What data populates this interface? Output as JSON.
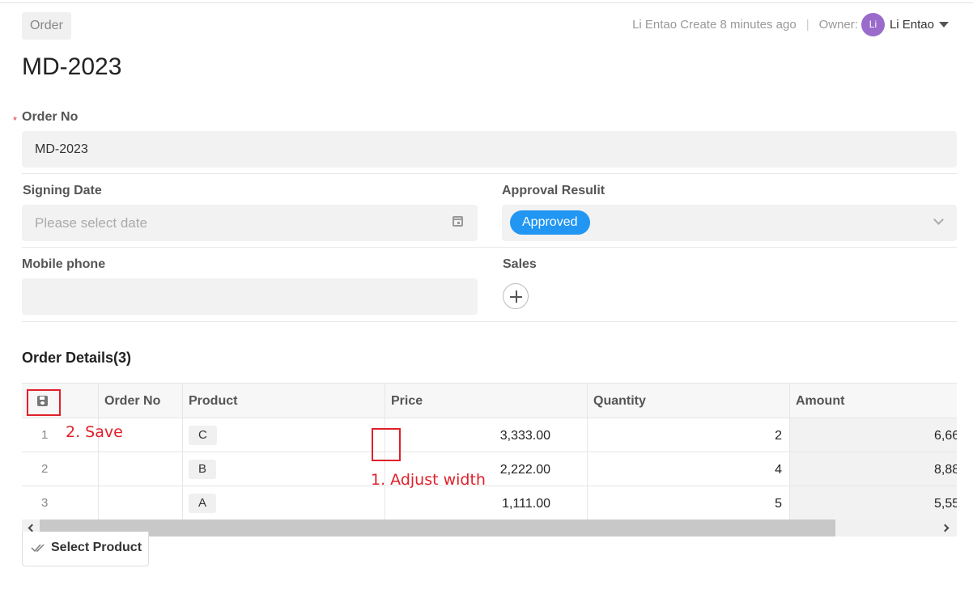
{
  "header": {
    "breadcrumb": "Order",
    "creator_text": "Li Entao Create 8 minutes ago",
    "separator": "|",
    "owner_label": "Owner:",
    "owner_initials": "Li",
    "owner_name": "Li Entao"
  },
  "title": "MD-2023",
  "form": {
    "order_no": {
      "label": "Order No",
      "required_mark": "*",
      "value": "MD-2023"
    },
    "signing_date": {
      "label": "Signing Date",
      "placeholder": "Please select date"
    },
    "approval_result": {
      "label": "Approval Resulit",
      "value": "Approved"
    },
    "mobile_phone": {
      "label": "Mobile phone",
      "value": ""
    },
    "sales": {
      "label": "Sales"
    }
  },
  "details": {
    "title": "Order Details(3)",
    "columns": [
      "",
      "Order No",
      "Product",
      "Price",
      "Quantity",
      "Amount"
    ],
    "rows": [
      {
        "index": "1",
        "order_no": "",
        "product": "C",
        "price": "3,333.00",
        "quantity": "2",
        "amount": "6,66"
      },
      {
        "index": "2",
        "order_no": "",
        "product": "B",
        "price": "2,222.00",
        "quantity": "4",
        "amount": "8,88"
      },
      {
        "index": "3",
        "order_no": "",
        "product": "A",
        "price": "1,111.00",
        "quantity": "5",
        "amount": "5,55"
      }
    ],
    "select_product_label": "Select Product"
  },
  "annotations": {
    "adjust_width": "1. Adjust width",
    "save": "2. Save",
    "color": "#e0202a"
  },
  "colors": {
    "accent": "#2196f3",
    "avatar": "#9a6bcb"
  }
}
